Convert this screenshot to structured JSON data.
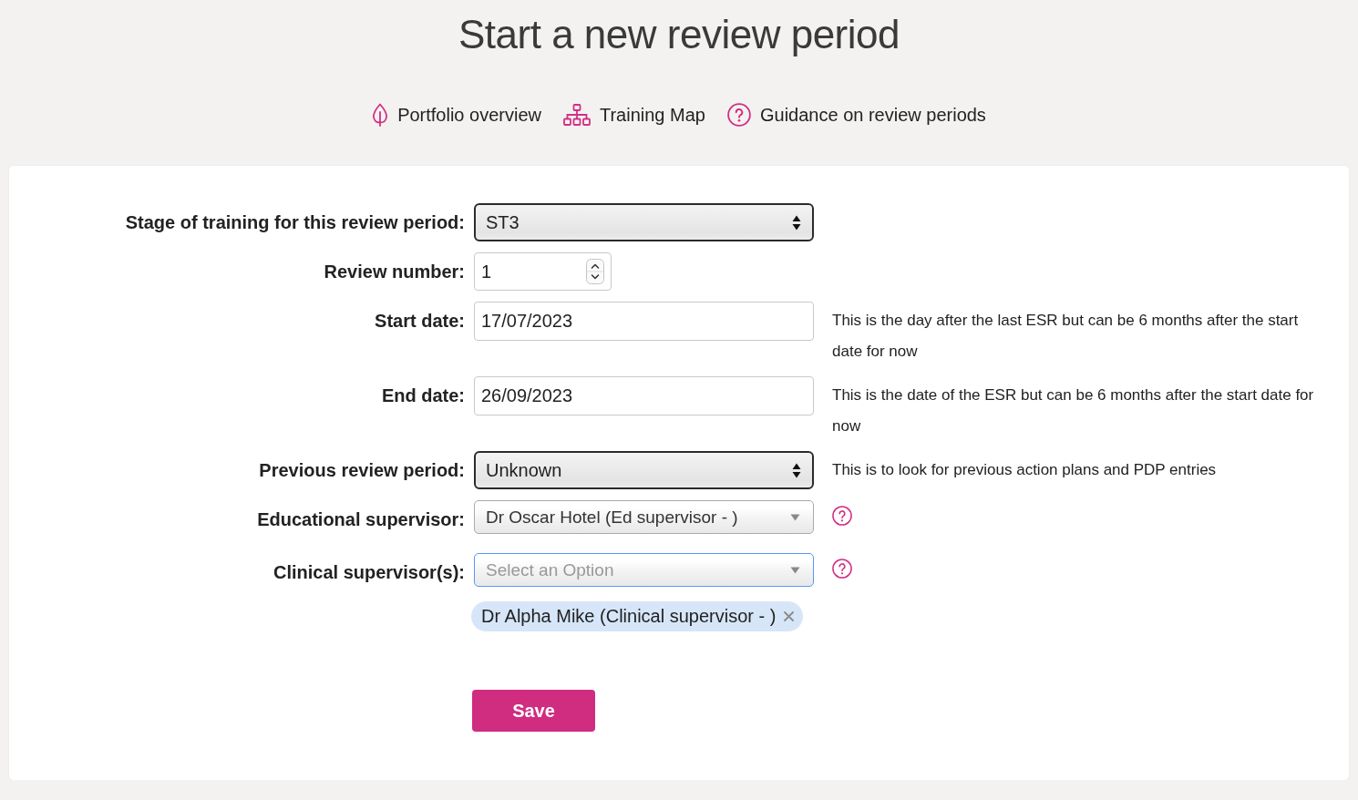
{
  "page_title": "Start a new review period",
  "nav_links": [
    {
      "label": "Portfolio overview"
    },
    {
      "label": "Training Map"
    },
    {
      "label": "Guidance on review periods"
    }
  ],
  "form": {
    "fields": [
      {
        "kind": "select",
        "label": "Stage of training for this review period:",
        "value": "ST3",
        "focused": false,
        "help_icon": false
      },
      {
        "kind": "number",
        "label": "Review number:",
        "value": "1",
        "focused": false,
        "help_icon": false
      },
      {
        "kind": "text",
        "label": "Start date:",
        "value": "17/07/2023",
        "help": "This is the day after the last ESR but can be 6 months after the start date for now",
        "focused": false,
        "help_icon": false
      },
      {
        "kind": "text",
        "label": "End date:",
        "value": "26/09/2023",
        "help": "This is the date of the ESR but can be 6 months after the start date for now",
        "focused": false,
        "help_icon": false
      },
      {
        "kind": "select",
        "label": "Previous review period:",
        "value": "Unknown",
        "help": "This is to look for previous action plans and PDP entries",
        "focused": false,
        "help_icon": false
      },
      {
        "kind": "combo",
        "label": "Educational supervisor:",
        "value": "Dr Oscar Hotel (Ed supervisor - )",
        "focused": false,
        "help_icon": true
      },
      {
        "kind": "combo",
        "label": "Clinical supervisor(s):",
        "placeholder": "Select an Option",
        "focused": true,
        "help_icon": true,
        "chips": [
          "Dr Alpha Mike (Clinical supervisor - )"
        ]
      }
    ]
  },
  "save_button": {
    "label": "Save"
  }
}
